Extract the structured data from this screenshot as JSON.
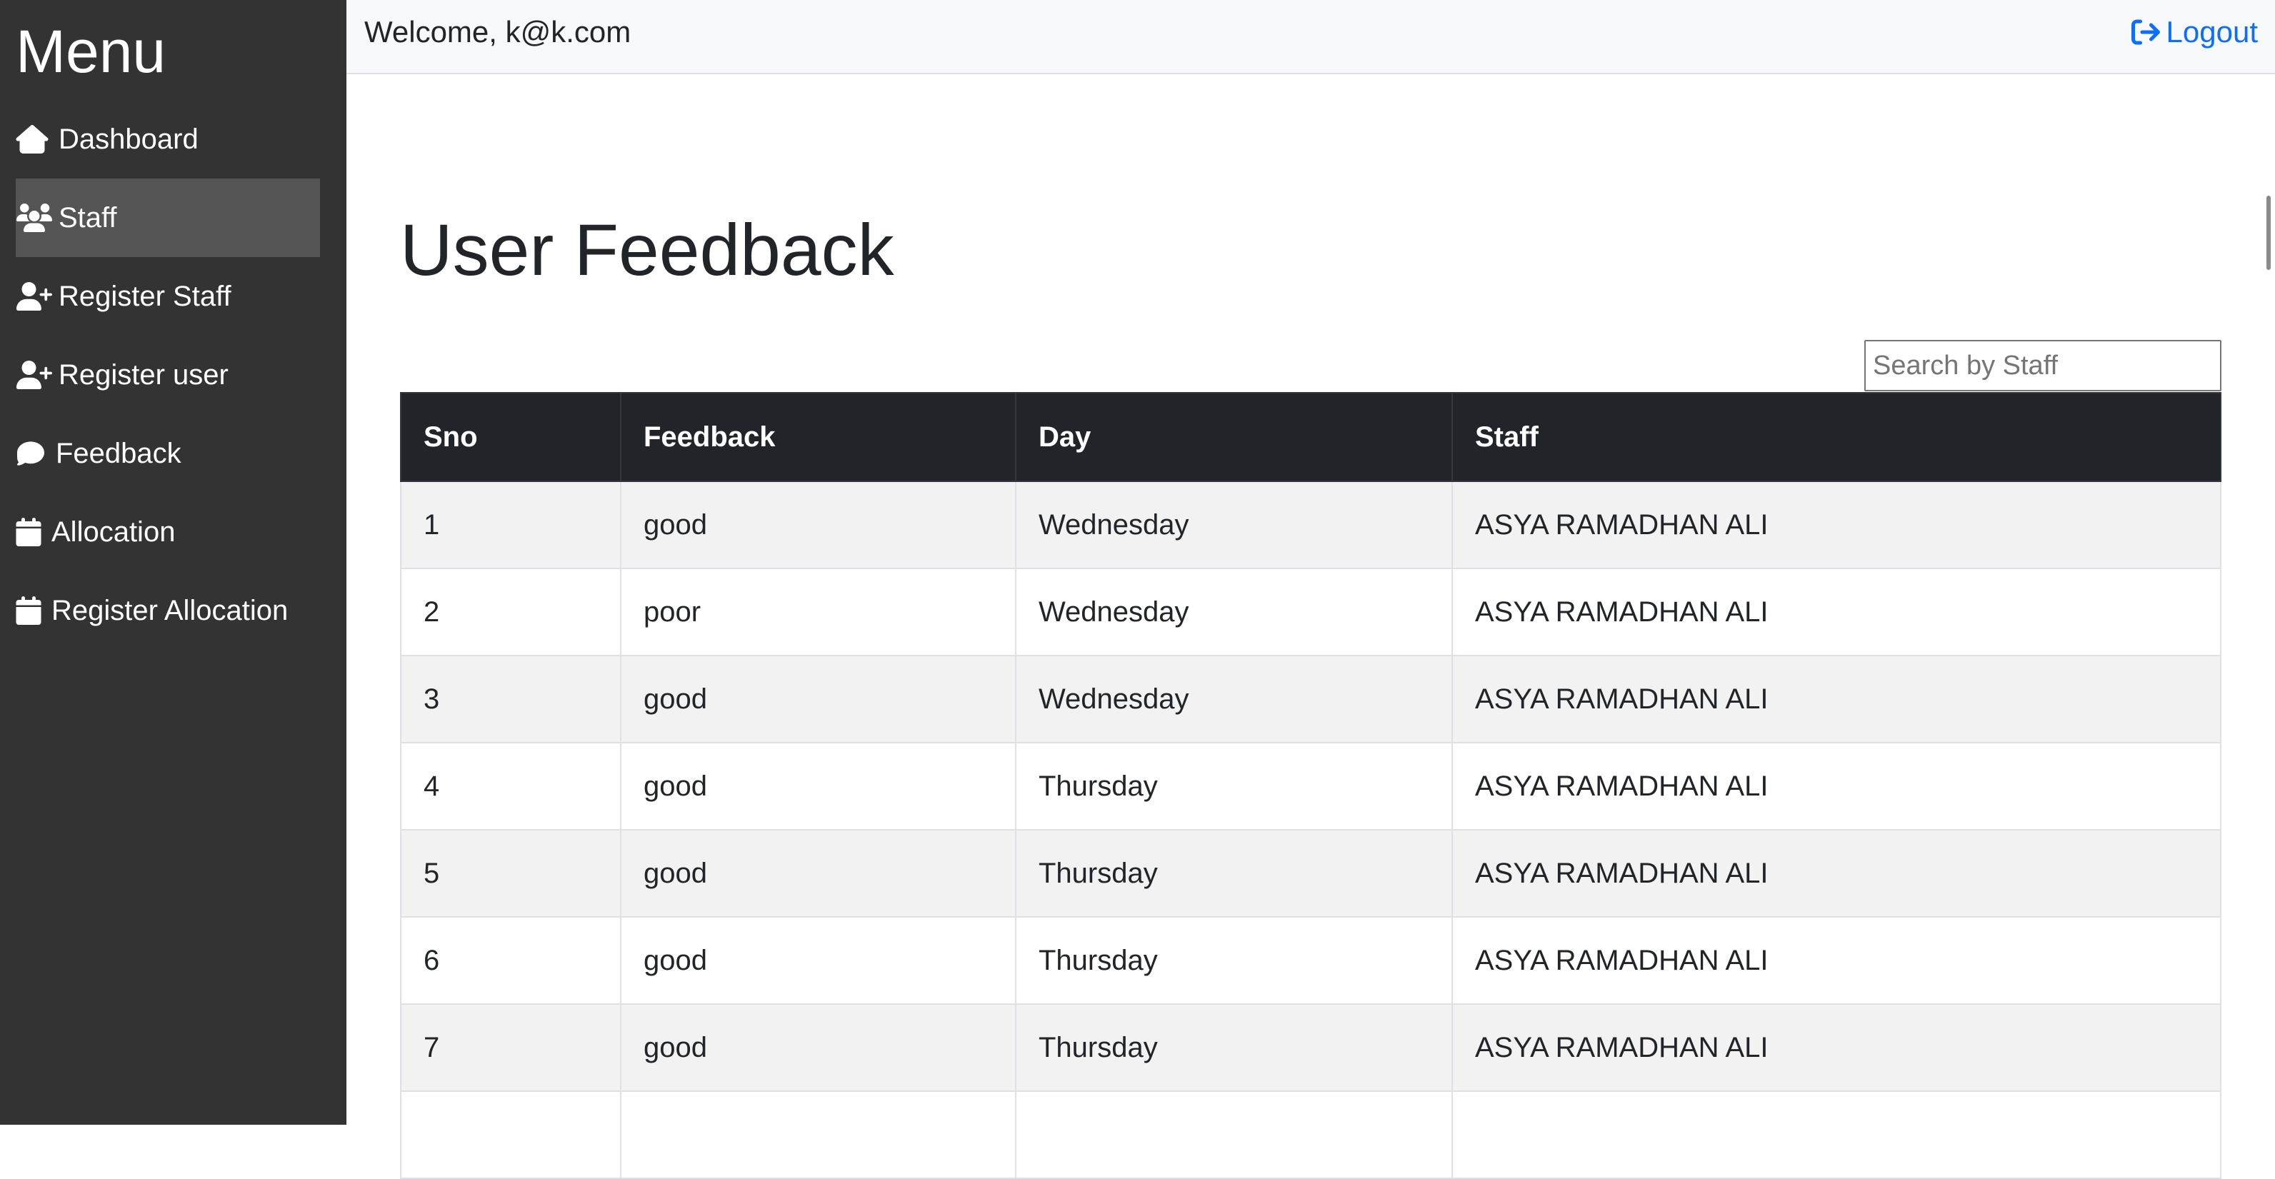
{
  "sidebar": {
    "title": "Menu",
    "items": [
      {
        "label": "Dashboard",
        "icon": "home-icon",
        "active": false
      },
      {
        "label": "Staff",
        "icon": "users-icon",
        "active": true
      },
      {
        "label": "Register Staff",
        "icon": "user-plus-icon",
        "active": false
      },
      {
        "label": "Register user",
        "icon": "user-plus-icon",
        "active": false
      },
      {
        "label": "Feedback",
        "icon": "comment-icon",
        "active": false
      },
      {
        "label": "Allocation",
        "icon": "calendar-icon",
        "active": false
      },
      {
        "label": "Register Allocation",
        "icon": "calendar-icon",
        "active": false
      }
    ]
  },
  "header": {
    "welcome": "Welcome, k@k.com",
    "logout_label": "Logout",
    "logout_icon": "sign-out-icon"
  },
  "main": {
    "title": "User Feedback",
    "search_placeholder": "Search by Staff",
    "table": {
      "columns": [
        "Sno",
        "Feedback",
        "Day",
        "Staff"
      ],
      "rows": [
        [
          "1",
          "good",
          "Wednesday",
          "ASYA RAMADHAN ALI"
        ],
        [
          "2",
          "poor",
          "Wednesday",
          "ASYA RAMADHAN ALI"
        ],
        [
          "3",
          "good",
          "Wednesday",
          "ASYA RAMADHAN ALI"
        ],
        [
          "4",
          "good",
          "Thursday",
          "ASYA RAMADHAN ALI"
        ],
        [
          "5",
          "good",
          "Thursday",
          "ASYA RAMADHAN ALI"
        ],
        [
          "6",
          "good",
          "Thursday",
          "ASYA RAMADHAN ALI"
        ],
        [
          "7",
          "good",
          "Thursday",
          "ASYA RAMADHAN ALI"
        ]
      ]
    }
  },
  "colors": {
    "sidebar_bg": "#333333",
    "sidebar_active": "#555555",
    "table_header_bg": "#212529",
    "link": "#0d6efd"
  }
}
